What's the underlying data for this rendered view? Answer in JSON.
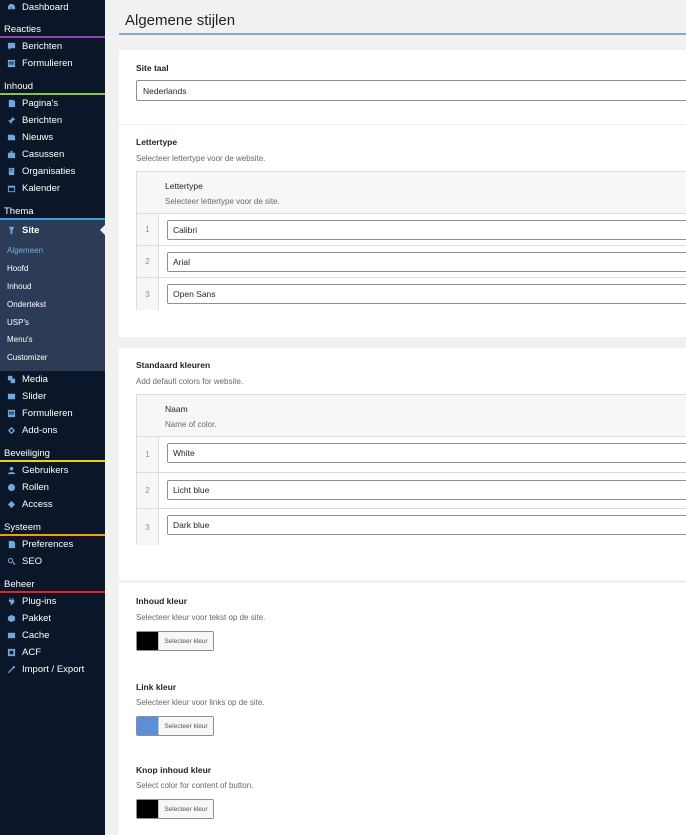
{
  "sidebar": {
    "top_item": "Dashboard",
    "sections": [
      {
        "key": "reacties",
        "title": "Reacties",
        "color": "#8e44ad",
        "items": [
          {
            "label": "Berichten",
            "icon": "comment-icon"
          },
          {
            "label": "Formulieren",
            "icon": "form-icon"
          }
        ]
      },
      {
        "key": "inhoud",
        "title": "Inhoud",
        "color": "#8bc34a",
        "items": [
          {
            "label": "Pagina's",
            "icon": "page-icon"
          },
          {
            "label": "Berichten",
            "icon": "pin-icon"
          },
          {
            "label": "Nieuws",
            "icon": "news-icon"
          },
          {
            "label": "Casussen",
            "icon": "case-icon"
          },
          {
            "label": "Organisaties",
            "icon": "building-icon"
          },
          {
            "label": "Kalender",
            "icon": "calendar-icon"
          }
        ]
      }
    ],
    "thema": {
      "title": "Thema",
      "color": "#3aa0e0",
      "active_label": "Site",
      "submenu": [
        "Algemeen",
        "Hoofd",
        "Inhoud",
        "Ondertekst",
        "USP's",
        "Menu's",
        "Customizer"
      ],
      "after_items": [
        {
          "label": "Media",
          "icon": "media-icon"
        },
        {
          "label": "Slider",
          "icon": "slider-icon"
        },
        {
          "label": "Formulieren",
          "icon": "form-icon"
        },
        {
          "label": "Add-ons",
          "icon": "addon-icon"
        }
      ]
    },
    "sections2": [
      {
        "key": "beveiliging",
        "title": "Beveiliging",
        "color": "#e6d31a",
        "items": [
          {
            "label": "Gebruikers",
            "icon": "user-icon"
          },
          {
            "label": "Rollen",
            "icon": "roles-icon"
          },
          {
            "label": "Access",
            "icon": "access-icon"
          }
        ]
      },
      {
        "key": "systeem",
        "title": "Systeem",
        "color": "#f39c12",
        "items": [
          {
            "label": "Preferences",
            "icon": "preferences-icon"
          },
          {
            "label": "SEO",
            "icon": "search-icon"
          }
        ]
      },
      {
        "key": "beheer",
        "title": "Beheer",
        "color": "#e02424",
        "items": [
          {
            "label": "Plug-ins",
            "icon": "plugin-icon"
          },
          {
            "label": "Pakket",
            "icon": "package-icon"
          },
          {
            "label": "Cache",
            "icon": "cache-icon"
          },
          {
            "label": "ACF",
            "icon": "acf-icon"
          },
          {
            "label": "Import / Export",
            "icon": "wrench-icon"
          }
        ]
      }
    ]
  },
  "page": {
    "title": "Algemene stijlen",
    "site_taal": {
      "label": "Site taal",
      "value": "Nederlands"
    },
    "lettertype": {
      "label": "Lettertype",
      "desc": "Selecteer lettertype voor de website.",
      "col_label": "Lettertype",
      "col_desc": "Selecteer lettertype voor de site.",
      "rows": [
        "Calibri",
        "Arial",
        "Open Sans"
      ]
    },
    "kleuren": {
      "label": "Standaard kleuren",
      "desc": "Add default colors for website.",
      "col_label": "Naam",
      "col_desc": "Name of color.",
      "rows": [
        "White",
        "Licht blue",
        "Dark blue"
      ]
    },
    "inhoud_kleur": {
      "label": "Inhoud kleur",
      "desc": "Selecteer kleur voor tekst op de site.",
      "button": "Selecteer kleur",
      "color": "#000000"
    },
    "link_kleur": {
      "label": "Link kleur",
      "desc": "Selecteer kleur voor links op de site.",
      "button": "Selecteer kleur",
      "color": "#5b8fd6"
    },
    "knop_kleur": {
      "label": "Knop inhoud kleur",
      "desc": "Select color for content of button.",
      "button": "Selecteer kleur",
      "color": "#000000"
    }
  }
}
